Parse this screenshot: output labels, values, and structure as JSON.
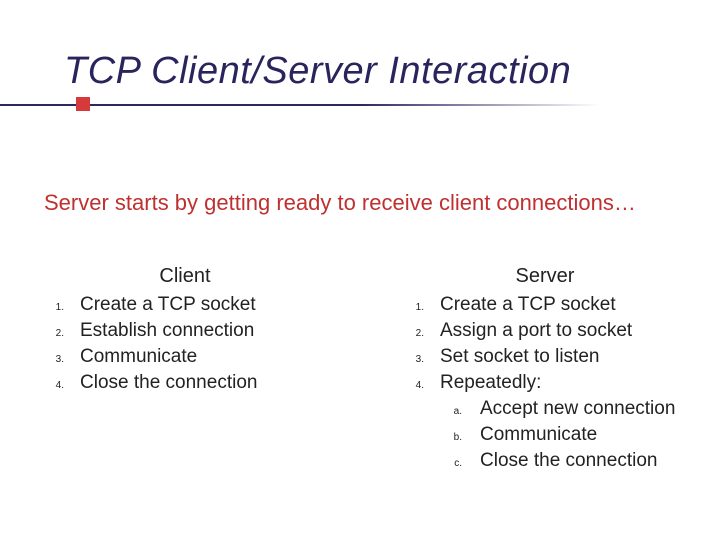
{
  "title": "TCP Client/Server Interaction",
  "subtitle": "Server starts by getting ready to receive client connections…",
  "client": {
    "header": "Client",
    "items": [
      "Create a TCP socket",
      "Establish connection",
      "Communicate",
      "Close the connection"
    ]
  },
  "server": {
    "header": "Server",
    "items": [
      "Create a TCP socket",
      "Assign a port to socket",
      "Set socket to listen",
      "Repeatedly:"
    ],
    "subitems": [
      "Accept new connection",
      "Communicate",
      "Close the connection"
    ]
  },
  "markers": {
    "num": [
      "1.",
      "2.",
      "3.",
      "4."
    ],
    "alpha": [
      "a.",
      "b.",
      "c."
    ]
  }
}
